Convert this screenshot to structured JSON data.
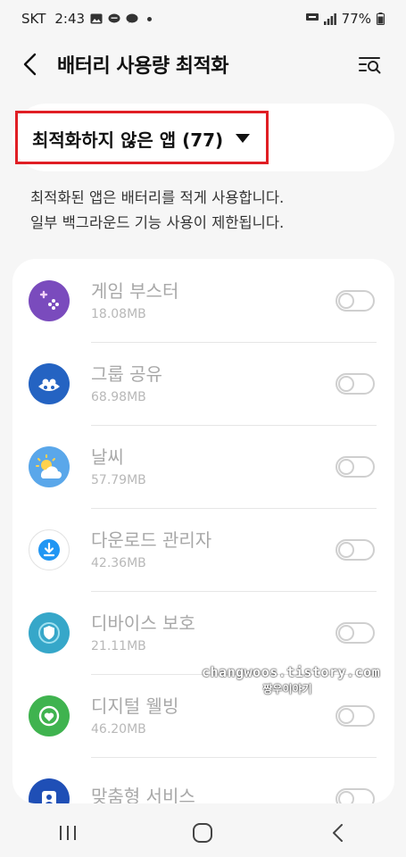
{
  "status_bar": {
    "carrier": "SKT",
    "time": "2:43",
    "battery": "77%",
    "notification_icons": [
      "image-icon",
      "chat-icon",
      "talk-icon"
    ]
  },
  "header": {
    "title": "배터리 사용량 최적화",
    "back_icon": "chevron-left-icon",
    "search_icon": "search-list-icon"
  },
  "filter": {
    "label": "최적화하지 않은 앱 (77)",
    "highlight_color": "#e01e24"
  },
  "description": {
    "line1": "최적화된 앱은 배터리를 적게 사용합니다.",
    "line2": "일부 백그라운드 기능 사용이 제한됩니다."
  },
  "apps": [
    {
      "name": "게임 부스터",
      "size": "18.08MB",
      "icon": "game-booster-icon",
      "color": "#7a4bbd"
    },
    {
      "name": "그룹 공유",
      "size": "68.98MB",
      "icon": "group-share-icon",
      "color": "#2463c2"
    },
    {
      "name": "날씨",
      "size": "57.79MB",
      "icon": "weather-icon",
      "color": "#5aa7ea"
    },
    {
      "name": "다운로드 관리자",
      "size": "42.36MB",
      "icon": "download-manager-icon",
      "color": "#2196f3"
    },
    {
      "name": "디바이스 보호",
      "size": "21.11MB",
      "icon": "device-protection-icon",
      "color": "#36a7c9"
    },
    {
      "name": "디지털 웰빙",
      "size": "46.20MB",
      "icon": "digital-wellbeing-icon",
      "color": "#3fb34f"
    },
    {
      "name": "맞춤형 서비스",
      "size": "",
      "icon": "personalized-service-icon",
      "color": "#1f4fb6"
    }
  ],
  "watermark": {
    "line1": "changwoos.tistory.com",
    "line2": "짱우이야기"
  },
  "nav": {
    "recents_icon": "recents-icon",
    "home_icon": "home-icon",
    "back_icon": "back-icon"
  }
}
